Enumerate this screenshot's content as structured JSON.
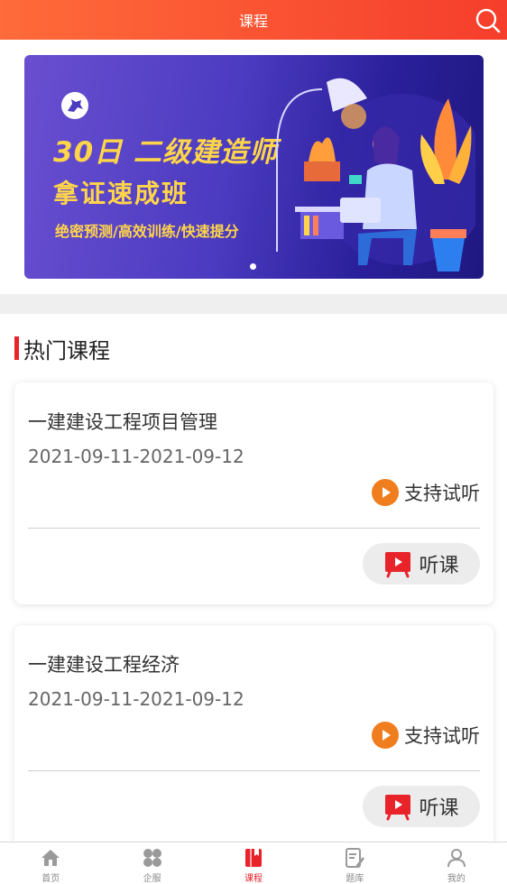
{
  "header": {
    "title": "课程",
    "search_icon": "search-icon"
  },
  "banner": {
    "line1": "30日 二级建造师",
    "line2": "拿证速成班",
    "line3": "绝密预测/高效训练/快速提分",
    "colors": {
      "accent": "#ffd54a",
      "bg_start": "#6a4fd0",
      "bg_end": "#1f1880"
    }
  },
  "section": {
    "title": "热门课程",
    "accent": "#e8232a"
  },
  "courses": [
    {
      "title": "一建建设工程项目管理",
      "date": "2021-09-11-2021-09-12",
      "trial_label": "支持试听",
      "listen_label": "听课"
    },
    {
      "title": "一建建设工程经济",
      "date": "2021-09-11-2021-09-12",
      "trial_label": "支持试听",
      "listen_label": "听课"
    }
  ],
  "tabbar": {
    "items": [
      {
        "label": "首页",
        "icon": "home-icon",
        "active": false
      },
      {
        "label": "企服",
        "icon": "grid-icon",
        "active": false
      },
      {
        "label": "课程",
        "icon": "book-icon",
        "active": true
      },
      {
        "label": "题库",
        "icon": "edit-doc-icon",
        "active": false
      },
      {
        "label": "我的",
        "icon": "user-icon",
        "active": false
      }
    ],
    "active_color": "#e8232a",
    "inactive_color": "#888888"
  }
}
